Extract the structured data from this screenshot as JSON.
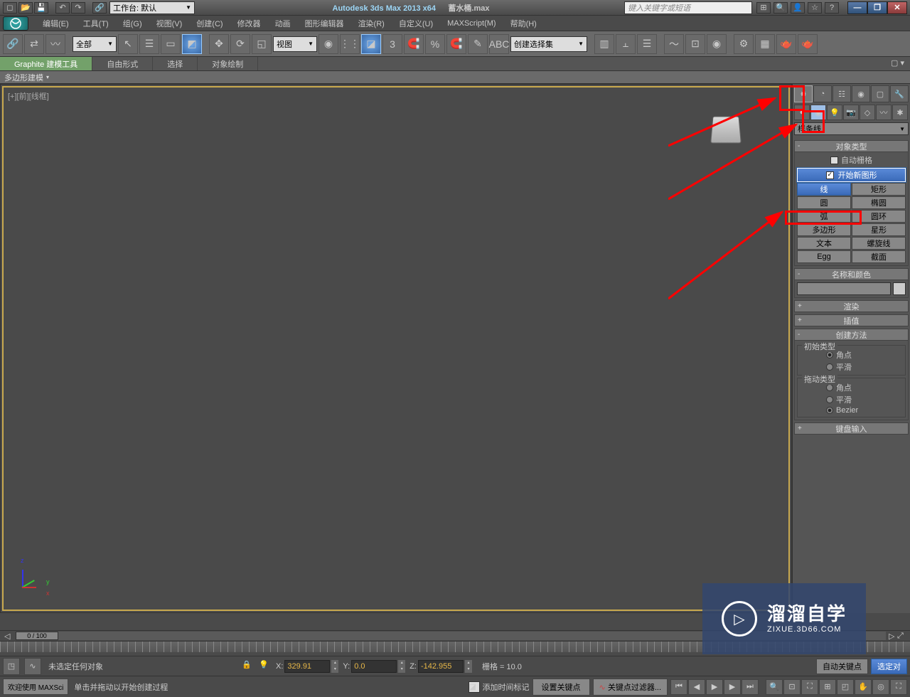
{
  "titlebar": {
    "workspace_label": "工作台: 默认",
    "app_title": "Autodesk 3ds Max  2013 x64",
    "file_name": "蓄水桶.max",
    "search_placeholder": "键入关键字或短语"
  },
  "menubar": {
    "items": [
      "编辑(E)",
      "工具(T)",
      "组(G)",
      "视图(V)",
      "创建(C)",
      "修改器",
      "动画",
      "图形编辑器",
      "渲染(R)",
      "自定义(U)",
      "MAXScript(M)",
      "帮助(H)"
    ]
  },
  "toolbar": {
    "filter_dd": "全部",
    "view_dd": "视图",
    "selset_dd": "创建选择集"
  },
  "ribbon": {
    "tabs": [
      "Graphite 建模工具",
      "自由形式",
      "选择",
      "对象绘制"
    ],
    "sub_label": "多边形建模"
  },
  "viewport": {
    "label": "[+][前][线框]"
  },
  "command_panel": {
    "category_dd": "样条线",
    "rollouts": {
      "object_type": {
        "title": "对象类型",
        "auto_grid": "自动栅格",
        "start_new_shape": "开始新图形"
      },
      "buttons": [
        {
          "label": "线",
          "active": true
        },
        {
          "label": "矩形"
        },
        {
          "label": "圆"
        },
        {
          "label": "椭圆"
        },
        {
          "label": "弧"
        },
        {
          "label": "圆环"
        },
        {
          "label": "多边形"
        },
        {
          "label": "星形"
        },
        {
          "label": "文本"
        },
        {
          "label": "螺旋线"
        },
        {
          "label": "Egg"
        },
        {
          "label": "截面"
        }
      ],
      "name_color": {
        "title": "名称和颜色"
      },
      "rendering": {
        "title": "渲染"
      },
      "interpolation": {
        "title": "插值"
      },
      "creation_method": {
        "title": "创建方法",
        "initial_label": "初始类型",
        "initial_options": [
          "角点",
          "平滑"
        ],
        "drag_label": "拖动类型",
        "drag_options": [
          "角点",
          "平滑",
          "Bezier"
        ]
      },
      "keyboard_entry": {
        "title": "键盘输入"
      }
    }
  },
  "timeline": {
    "slider_text": "0 / 100"
  },
  "trackbar": {
    "status1": "未选定任何对象",
    "coord_x": "329.91",
    "coord_y": "0.0",
    "coord_z": "-142.955",
    "grid_text": "栅格 = 10.0",
    "auto_key": "自动关键点",
    "sel_lock": "选定对"
  },
  "statusbar": {
    "welcome": "欢迎使用  MAXSci",
    "prompt": "单击并拖动以开始创建过程",
    "add_time_tag": "添加时间标记",
    "set_key": "设置关键点",
    "key_filter": "关键点过滤器..."
  },
  "watermark": {
    "big": "溜溜自学",
    "small": "ZIXUE.3D66.COM"
  },
  "axes": {
    "x": "x",
    "y": "y",
    "z": "z"
  }
}
